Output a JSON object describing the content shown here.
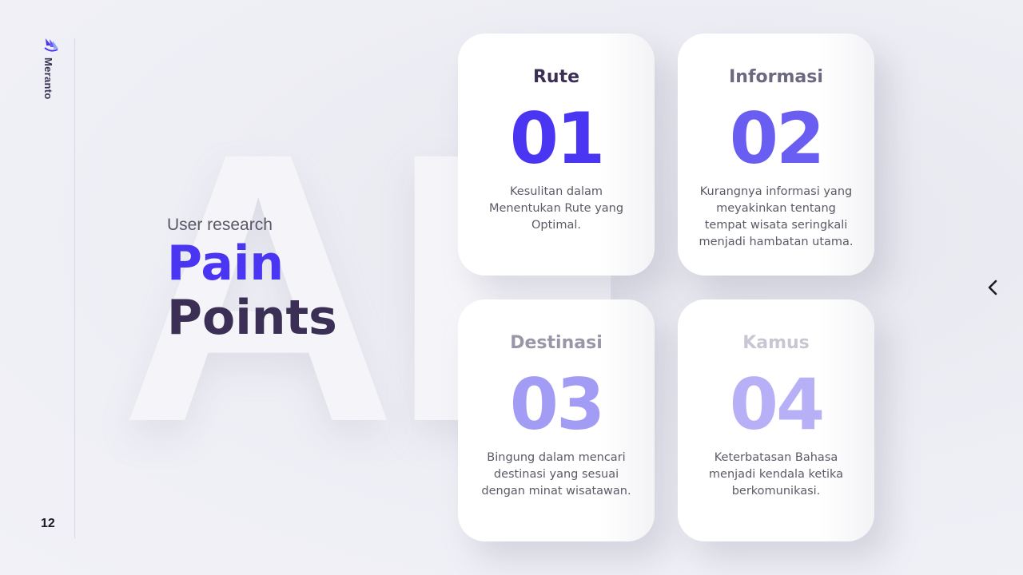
{
  "brand": {
    "name": "Meranto",
    "icon": "meranto-logo-icon"
  },
  "page_number": "12",
  "watermark": "AE",
  "heading": {
    "subtitle": "User research",
    "title_line1": "Pain",
    "title_line2": "Points"
  },
  "cards": [
    {
      "title": "Rute",
      "number": "01",
      "description": "Kesulitan dalam Menentukan Rute yang Optimal.",
      "title_color": "#3b2f55",
      "number_color": "#4a36f2"
    },
    {
      "title": "Informasi",
      "number": "02",
      "description": "Kurangnya informasi yang meyakinkan tentang tempat wisata seringkali menjadi hambatan utama.",
      "title_color": "#6e6780",
      "number_color": "#6a5ef2"
    },
    {
      "title": "Destinasi",
      "number": "03",
      "description": "Bingung dalam mencari destinasi yang sesuai dengan minat wisatawan.",
      "title_color": "#9a96a8",
      "number_color": "#a39cf5"
    },
    {
      "title": "Kamus",
      "number": "04",
      "description": "Keterbatasan Bahasa menjadi kendala ketika berkomunikasi.",
      "title_color": "#c9c6d3",
      "number_color": "#b7b0f7"
    }
  ],
  "navigation": {
    "prev_icon": "chevron-left-icon"
  },
  "colors": {
    "accent": "#4a36f2",
    "dark": "#3b2f55",
    "background": "#eeeef5"
  }
}
